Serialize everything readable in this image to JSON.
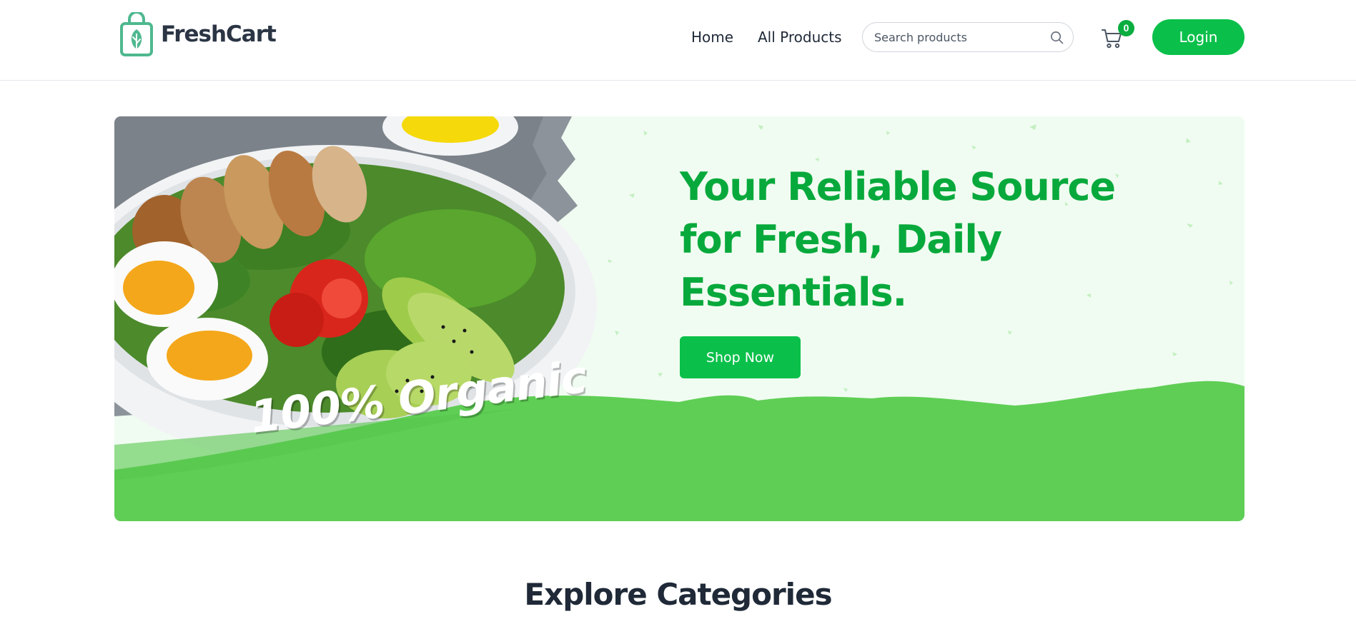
{
  "brand": {
    "name": "FreshCart",
    "icon": "shopping-bag-leaf-icon",
    "color": "#0aad3f"
  },
  "nav": {
    "home_label": "Home",
    "products_label": "All Products"
  },
  "search": {
    "placeholder": "Search products",
    "value": "",
    "icon": "search-icon"
  },
  "cart": {
    "icon": "cart-icon",
    "count": "0"
  },
  "login": {
    "label": "Login"
  },
  "hero": {
    "title": "Your Reliable Source for Fresh, Daily Essentials.",
    "cta_label": "Shop Now",
    "badge_text": "100% Organic",
    "title_color": "#08a93c",
    "band_color": "#5fce55"
  },
  "categories": {
    "title": "Explore Categories"
  },
  "colors": {
    "accent": "#0ac04a",
    "text": "#1f2937"
  }
}
